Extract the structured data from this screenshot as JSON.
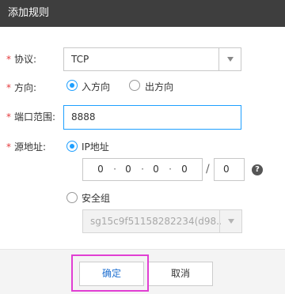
{
  "dialog": {
    "title": "添加规则"
  },
  "form": {
    "protocol": {
      "label": "协议:",
      "value": "TCP"
    },
    "direction": {
      "label": "方向:",
      "options": [
        {
          "label": "入方向",
          "checked": true
        },
        {
          "label": "出方向",
          "checked": false
        }
      ]
    },
    "port_range": {
      "label": "端口范围:",
      "value": "8888"
    },
    "source": {
      "label": "源地址:",
      "ip_option_label": "IP地址",
      "ip_octets": [
        "0",
        "0",
        "0",
        "0"
      ],
      "ip_separator": "·",
      "slash": "/",
      "mask": "0",
      "help_glyph": "?",
      "sg_option_label": "安全组",
      "sg_value": "sg15c9f51158282234(d98..."
    },
    "required_mark": "*"
  },
  "footer": {
    "confirm_label": "确定",
    "cancel_label": "取消"
  },
  "colors": {
    "accent": "#1e9fff",
    "highlight": "#e13fd3",
    "titlebar": "#3e3e3e"
  }
}
